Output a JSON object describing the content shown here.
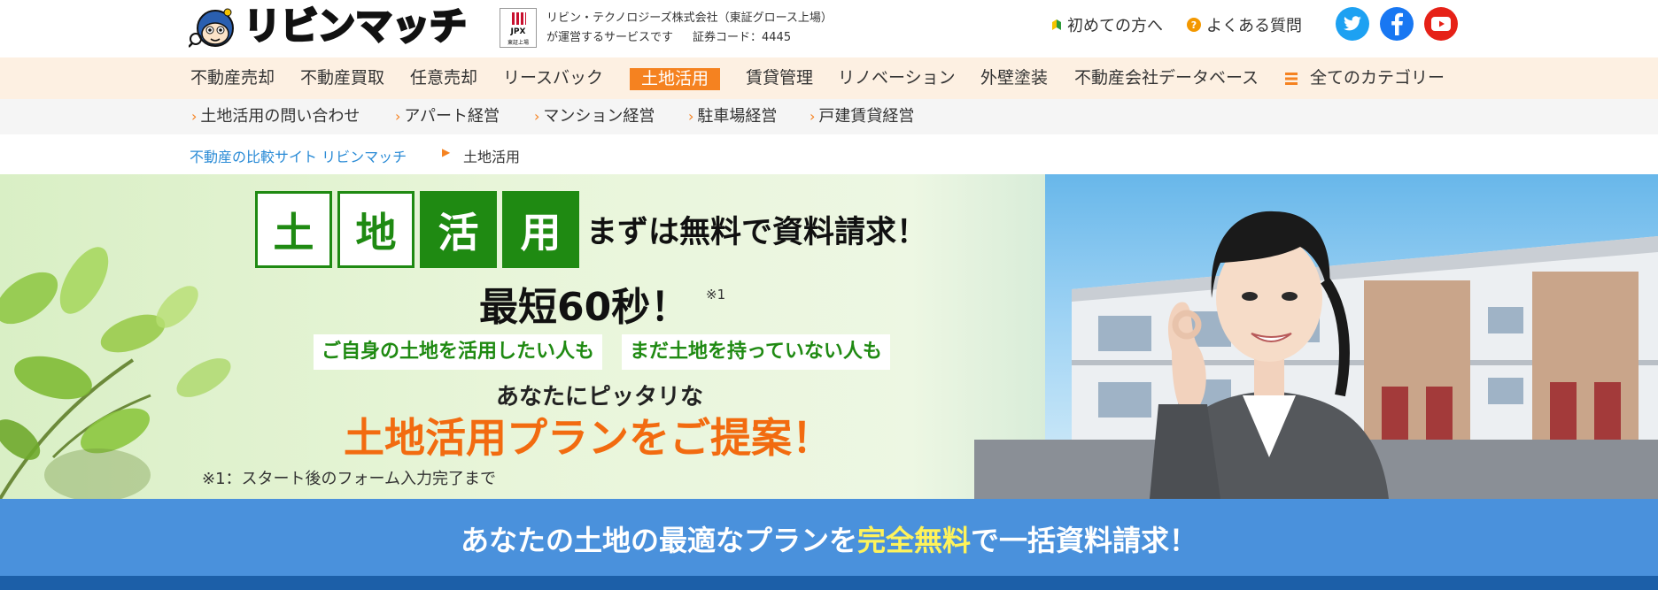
{
  "header": {
    "logo_text": "リビンマッチ",
    "jpx": {
      "line1": "JPX",
      "line2": "東証上場"
    },
    "corp_line1": "リビン・テクノロジーズ株式会社（東証グロース上場）",
    "corp_line2": "が運営するサービスです",
    "corp_code": "証券コード：4445",
    "link_beginner": "初めての方へ",
    "link_faq": "よくある質問",
    "faq_icon_text": "?",
    "social": [
      {
        "name": "twitter",
        "color": "#1da1f2"
      },
      {
        "name": "facebook",
        "color": "#1877f2"
      },
      {
        "name": "youtube",
        "color": "#ff0000"
      }
    ]
  },
  "main_nav": {
    "items": [
      "不動産売却",
      "不動産買取",
      "任意売却",
      "リースバック",
      "土地活用",
      "賃貸管理",
      "リノベーション",
      "外壁塗装",
      "不動産会社データベース"
    ],
    "active": "土地活用",
    "all_categories": "全てのカテゴリー"
  },
  "sub_nav": {
    "chevron": "›",
    "items": [
      "土地活用の問い合わせ",
      "アパート経営",
      "マンション経営",
      "駐車場経営",
      "戸建賃貸経営"
    ]
  },
  "breadcrumb": {
    "home": "不動産の比較サイト リビンマッチ",
    "separator": "▶",
    "current": "土地活用"
  },
  "hero": {
    "kanji": [
      "土",
      "地",
      "活",
      "用"
    ],
    "headline": "まずは無料で資料請求！",
    "fast": "最短60秒！",
    "fast_note": "※1",
    "pill1": "ご自身の土地を活用したい人も",
    "pill2": "まだ土地を持っていない人も",
    "lead": "あなたにピッタリな",
    "proposal": "土地活用プランをご提案！",
    "footnote": "※1：スタート後のフォーム入力完了まで"
  },
  "cta": {
    "before": "あなたの土地の最適なプランを",
    "highlight": "完全無料",
    "after": "で一括資料請求！"
  },
  "colors": {
    "accent_orange": "#f58220",
    "green": "#1f8a12",
    "link_blue": "#2a8bd6",
    "cta_blue": "#4a91dc",
    "cta_highlight": "#fff35a"
  }
}
